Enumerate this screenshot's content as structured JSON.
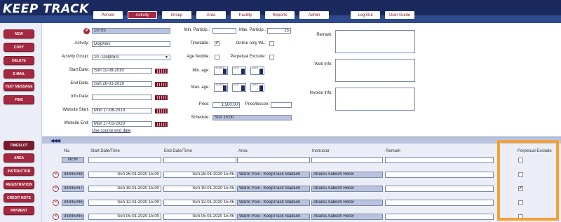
{
  "app": {
    "logo": "KEEP TRACK"
  },
  "nav": {
    "tabs": [
      "Person",
      "Activity",
      "Group",
      "Area",
      "Facility",
      "Reports",
      "Admin"
    ],
    "active": "Activity",
    "logout": "Log Out",
    "user_guide": "User Guide"
  },
  "sidebar": {
    "top": [
      "NEW",
      "COPY",
      "DELETE",
      "E-MAIL",
      "TEXT MESSAGE",
      "FIND"
    ],
    "bottom": [
      "TIMESLOT",
      "AREA",
      "INSTRUCTOR",
      "REGISTRATION",
      "CREDIT NOTE",
      "PAYMENT"
    ],
    "selected": "TIMESLOT"
  },
  "form": {
    "id_icon": "#",
    "id_value": "10755",
    "activity_label": "Activity:",
    "activity_value": "Dolphins",
    "group_label": "Activity Group:",
    "group_value": "10 - Dolphins",
    "start_label": "Start Date:",
    "start_value": "Sun 11-08-2019",
    "end_label": "End Date:",
    "end_value": "Sun 26-01-2020",
    "info_label": "Info Date:",
    "info_value": "",
    "web_start_label": "Website Start:",
    "web_start_value": "Mon 17-06-2019",
    "web_end_label": "Website End:",
    "web_end_value": "Mon 27-01-2020",
    "use_course_end": "Use course end date",
    "min_particip_label": "Min. Particip.:",
    "min_particip_value": "",
    "max_particip_label": "Max. Particip.:",
    "max_particip_value": "15",
    "timetable_label": "Timetable:",
    "timetable_checked": true,
    "online_only_label": "Online only WL:",
    "online_only_checked": false,
    "age_flexible_label": "Age flexible:",
    "age_flexible_checked": false,
    "perpetual_exclude_label": "Perpetual Exclude:",
    "perpetual_exclude_checked": false,
    "min_age_label": "Min. age:",
    "max_age_label": "Max. age:",
    "spinner_caps": [
      "YEARS",
      "MOS",
      "DAYS"
    ],
    "price_label": "Price:",
    "price_value": "1,500.00",
    "price_lesson_label": "Price/lesson:",
    "price_lesson_value": "",
    "schedule_label": "Schedule:",
    "schedule_value": "Sun 15:00",
    "remark_label": "Remark:",
    "webinfo_label": "Web Info:",
    "invoiceinfo_label": "Invoice Info:"
  },
  "timeslots": {
    "headers": {
      "no": "No.",
      "start": "Start Date/Time",
      "end": "End Date/Time",
      "area": "Area",
      "instructor": "Instructor",
      "remark": "Remark",
      "perpetual": "Perpetual Exclude"
    },
    "new_label": "NEW",
    "rows": [
      {
        "no": "34845048",
        "start": "Sun 26-01-2020 15:00",
        "end": "Sun 26-01-2020 15:45",
        "area": "Warm Pool - KeepTrack Stadium",
        "instructor": "Abares Aabech Heller",
        "remark": "",
        "perpetual": false
      },
      {
        "no": "34845047",
        "start": "Sun 19-01-2020 15:00",
        "end": "Sun 19-01-2020 15:45",
        "area": "Warm Pool - KeepTrack Stadium",
        "instructor": "Abares Aabech Heller",
        "remark": "",
        "perpetual": true
      },
      {
        "no": "34845046",
        "start": "Sun 12-01-2020 15:00",
        "end": "Sun 12-01-2020 15:45",
        "area": "Warm Pool - KeepTrack Stadium",
        "instructor": "Abares Aabech Heller",
        "remark": "",
        "perpetual": false
      },
      {
        "no": "34845045",
        "start": "Sun 05-01-2020 15:00",
        "end": "Sun 05-01-2020 15:45",
        "area": "Warm Pool - KeepTrack Stadium",
        "instructor": "Abares Aabech Heller",
        "remark": "",
        "perpetual": false
      }
    ]
  },
  "colors": {
    "brand": "#1b2a5e",
    "accent": "#a4283f",
    "highlight": "#f5a032"
  }
}
